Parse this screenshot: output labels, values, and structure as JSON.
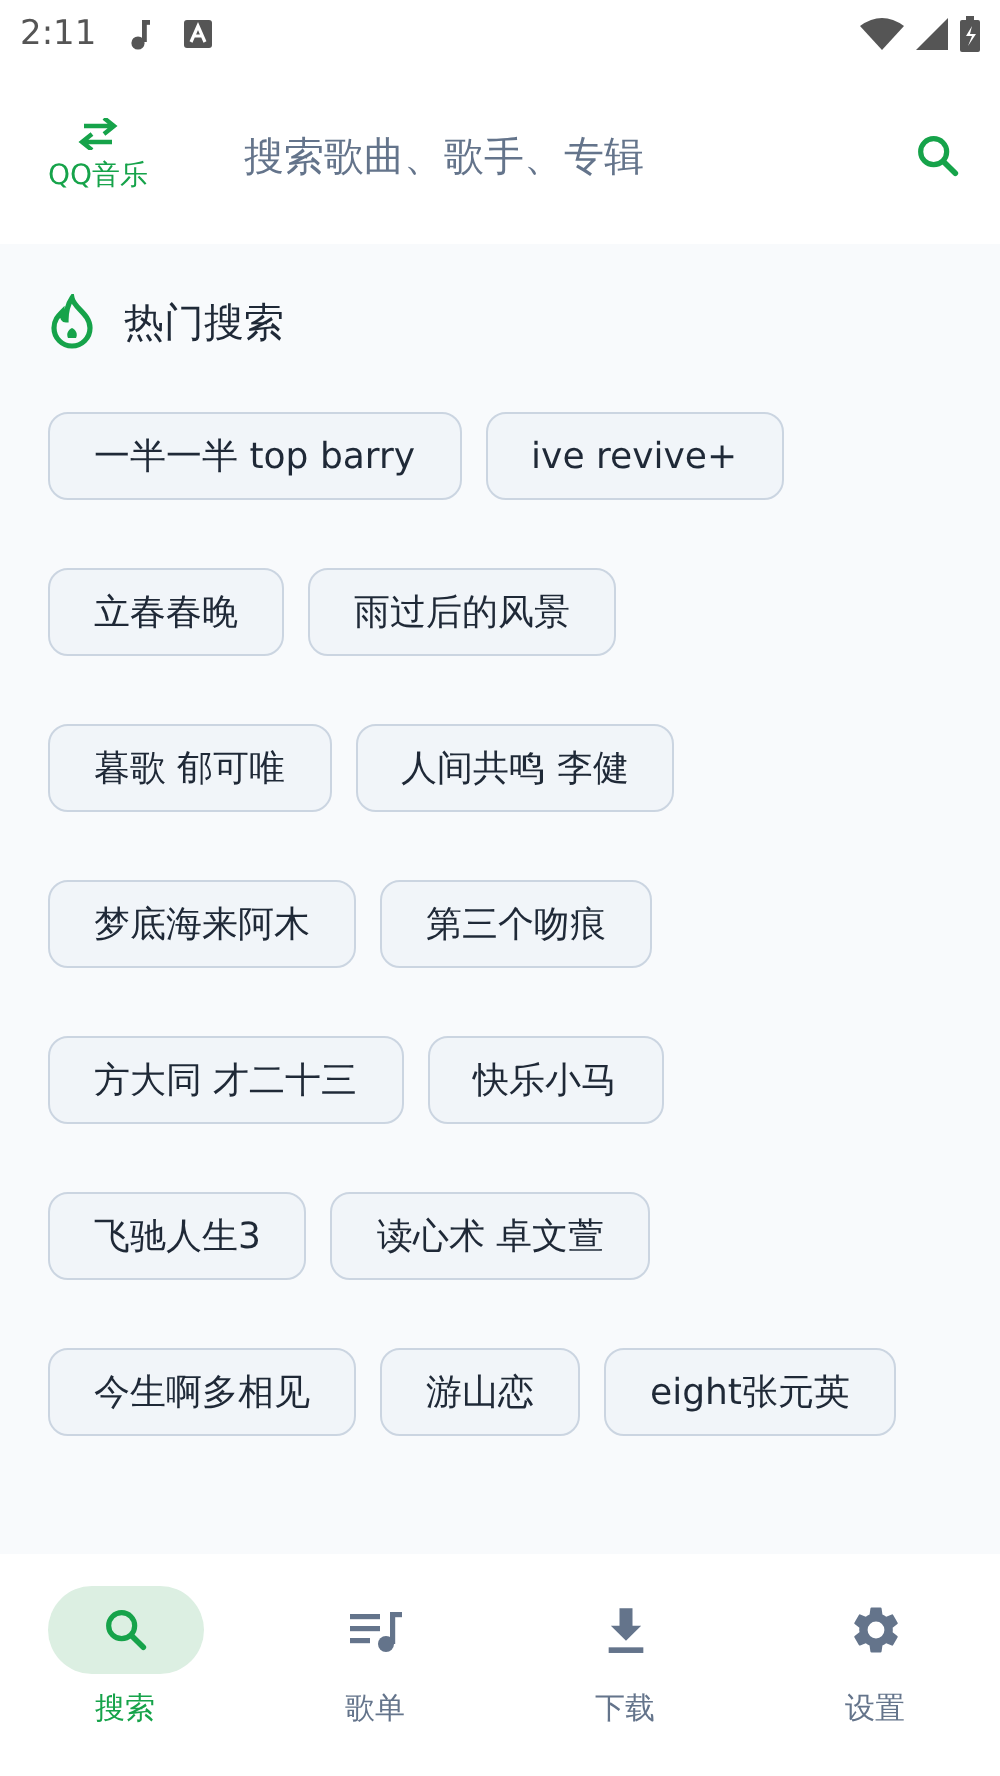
{
  "status_bar": {
    "time": "2:11"
  },
  "header": {
    "logo_label": "QQ音乐",
    "search": {
      "placeholder": "搜索歌曲、歌手、专辑"
    }
  },
  "hot_search": {
    "title": "热门搜索",
    "rows": [
      [
        "一半一半 top barry",
        "ive revive+"
      ],
      [
        "立春春晚",
        "雨过后的风景"
      ],
      [
        "暮歌 郁可唯",
        "人间共鸣 李健"
      ],
      [
        "梦底海来阿木",
        "第三个吻痕"
      ],
      [
        "方大同 才二十三",
        "快乐小马"
      ],
      [
        "飞驰人生3",
        "读心术 卓文萱"
      ],
      [
        "今生啊多相见",
        "游山恋",
        "eight张元英"
      ]
    ]
  },
  "bottom_nav": [
    {
      "kind": "search",
      "label": "搜索",
      "selected": true
    },
    {
      "kind": "playlist",
      "label": "歌单",
      "selected": false
    },
    {
      "kind": "download",
      "label": "下载",
      "selected": false
    },
    {
      "kind": "settings",
      "label": "设置",
      "selected": false
    }
  ]
}
